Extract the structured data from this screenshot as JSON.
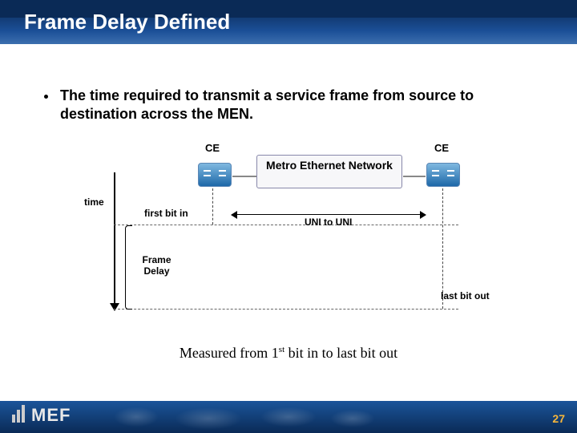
{
  "title": "Frame Delay Defined",
  "bullet": "The time required to transmit a service frame from source to destination across the MEN.",
  "diagram": {
    "ce_left": "CE",
    "ce_right": "CE",
    "men_box": "Metro Ethernet Network",
    "time_label": "time",
    "first_bit": "first bit in",
    "last_bit": "last bit out",
    "frame_delay": "Frame Delay",
    "uni": "UNI to UNI"
  },
  "caption_lead": "Measured from 1",
  "caption_sup": "st",
  "caption_rest": " bit in to last bit out",
  "footer": {
    "logo": "MEF",
    "page": "27"
  }
}
